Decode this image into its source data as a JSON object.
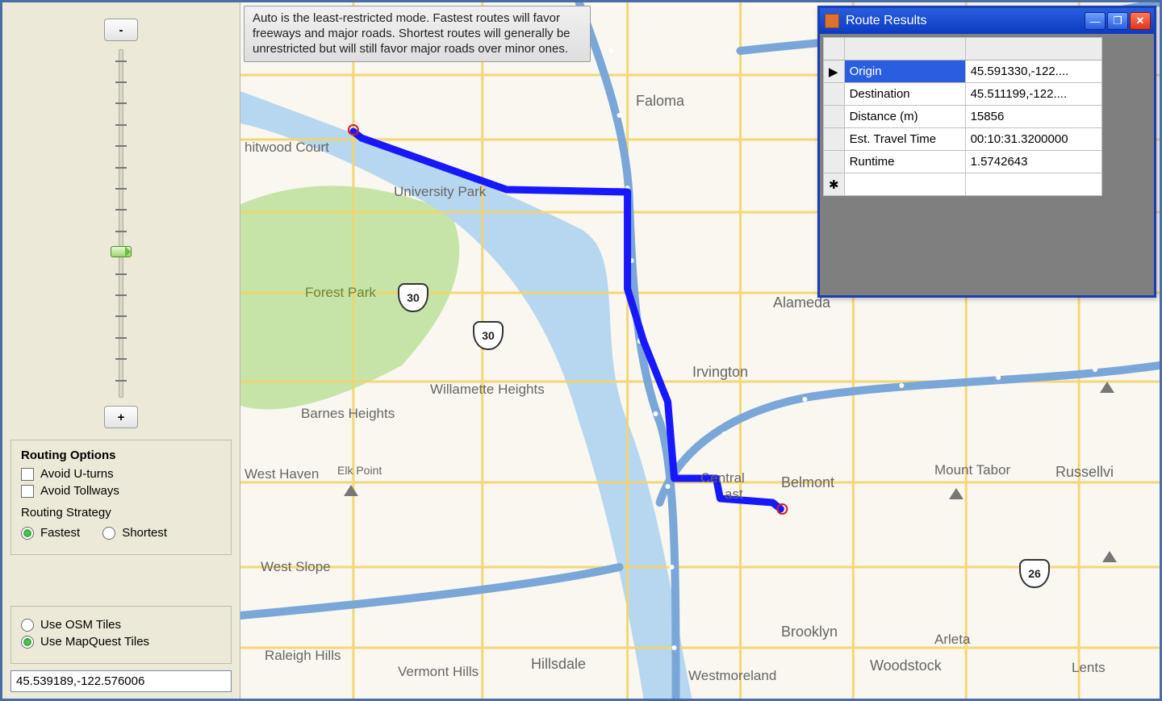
{
  "info_text": "Auto is the least-restricted mode. Fastest routes will favor freeways and major roads. Shortest routes will generally be unrestricted but will still favor major roads over minor ones.",
  "zoom": {
    "minus": "-",
    "plus": "+"
  },
  "options": {
    "title": "Routing Options",
    "avoid_uturns": "Avoid U-turns",
    "avoid_tollways": "Avoid Tollways",
    "strategy_label": "Routing Strategy",
    "fastest": "Fastest",
    "shortest": "Shortest"
  },
  "tiles": {
    "osm": "Use OSM Tiles",
    "mapquest": "Use MapQuest Tiles"
  },
  "coords_input": "45.539189,-122.576006",
  "map_labels": {
    "faloma": "Faloma",
    "hitwood": "hitwood Court",
    "univpark": "University Park",
    "forest": "Forest Park",
    "willamette": "Willamette Heights",
    "barnes": "Barnes Heights",
    "westhaven": "West Haven",
    "elk": "Elk Point",
    "alameda": "Alameda",
    "irvington": "Irvington",
    "central": "Central",
    "east": "ast",
    "belmont": "Belmont",
    "mount_tabor": "Mount Tabor",
    "russellvi": "Russellvi",
    "brooklyn": "Brooklyn",
    "arleta": "Arleta",
    "woodstock": "Woodstock",
    "lents": "Lents",
    "westslope": "West Slope",
    "raleigh": "Raleigh Hills",
    "vermont": "Vermont Hills",
    "hillsdale": "Hillsdale",
    "westmoreland": "Westmoreland",
    "sh30a": "30",
    "sh30b": "30",
    "sh26": "26"
  },
  "results": {
    "title": "Route Results",
    "rows": [
      {
        "k": "Origin",
        "v": "45.591330,-122...."
      },
      {
        "k": "Destination",
        "v": "45.511199,-122...."
      },
      {
        "k": "Distance (m)",
        "v": "15856"
      },
      {
        "k": "Est. Travel Time",
        "v": "00:10:31.3200000"
      },
      {
        "k": "Runtime",
        "v": "1.5742643"
      }
    ],
    "newrow": "✱"
  }
}
